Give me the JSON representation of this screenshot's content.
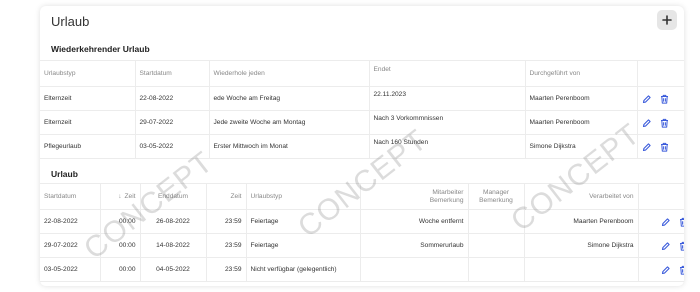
{
  "card": {
    "title": "Urlaub",
    "add_button_label": "+"
  },
  "recurring": {
    "section_title": "Wiederkehrender Urlaub",
    "headers": [
      "Urlaubstyp",
      "Startdatum",
      "Wiederhole jeden",
      "Endet",
      "Durchgeführt von"
    ],
    "rows": [
      {
        "type": "Elternzeit",
        "start": "22-08-2022",
        "repeat": "ede Woche am Freitag",
        "ends": "22.11.2023",
        "by": "Maarten Perenboom"
      },
      {
        "type": "Elternzeit",
        "start": "29-07-2022",
        "repeat": "Jede zweite Woche am Montag",
        "ends": "Nach 3 Vorkommnissen",
        "by": "Maarten Perenboom"
      },
      {
        "type": "Pflegeurlaub",
        "start": "03-05-2022",
        "repeat": "Erster Mittwoch im Monat",
        "ends": "Nach 160 Stunden",
        "by": "Simone Dijkstra"
      }
    ]
  },
  "leave": {
    "section_title": "Urlaub",
    "headers": {
      "start": "Startdatum",
      "sort_arrow": "↓",
      "time1": "Zeit",
      "end": "Enddatum",
      "time2": "Zeit",
      "type": "Urlaubstyp",
      "employee_note_line1": "Mitarbeiter",
      "employee_note_line2": "Bemerkung",
      "manager_note_line1": "Manager",
      "manager_note_line2": "Bemerkung",
      "processed_by": "Verarbeitet von"
    },
    "rows": [
      {
        "start": "22-08-2022",
        "time1": "00:00",
        "end": "26-08-2022",
        "time2": "23:59",
        "type": "Feiertage",
        "employee_note": "Woche entfernt",
        "manager_note": "",
        "processed_by": "Maarten Perenboom"
      },
      {
        "start": "29-07-2022",
        "time1": "00:00",
        "end": "14-08-2022",
        "time2": "23:59",
        "type": "Feiertage",
        "employee_note": "Sommerurlaub",
        "manager_note": "",
        "processed_by": "Simone Dijkstra"
      },
      {
        "start": "03-05-2022",
        "time1": "00:00",
        "end": "04-05-2022",
        "time2": "23:59",
        "type": "Nicht verfügbar (gelegentlich)",
        "employee_note": "",
        "manager_note": "",
        "processed_by": ""
      }
    ]
  },
  "watermark_text": "CONCEPT",
  "colors": {
    "icon_blue": "#3b5bdb",
    "header_text": "#888888",
    "add_button_bg": "#e6e6e6"
  },
  "icons": {
    "edit": "pencil-icon",
    "delete": "trash-icon",
    "add": "plus-icon"
  }
}
